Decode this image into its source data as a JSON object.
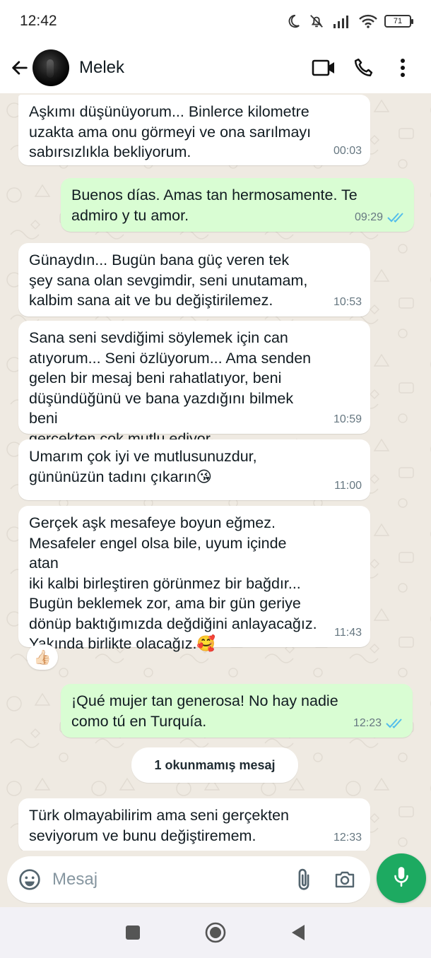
{
  "status_bar": {
    "time": "12:42",
    "battery": "71"
  },
  "header": {
    "contact_name": "Melek"
  },
  "messages": [
    {
      "direction": "in",
      "text": "Aşkımı düşünüyorum... Binlerce kilometre\nuzakta ama onu görmeyi ve ona sarılmayı\nsabırsızlıkla bekliyorum.",
      "time": "00:03"
    },
    {
      "direction": "out",
      "text": "Buenos días. Amas tan hermosamente. Te\nadmiro y tu amor.",
      "time": "09:29",
      "status": "read"
    },
    {
      "direction": "in",
      "text": "Günaydın... Bugün bana güç veren tek\nşey sana olan sevgimdir, seni unutamam,\nkalbim sana ait ve bu değiştirilemez.",
      "time": "10:53"
    },
    {
      "direction": "in",
      "text": "Sana seni sevdiğimi söylemek için can\natıyorum... Seni özlüyorum... Ama senden\ngelen bir mesaj beni rahatlatıyor, beni\ndüşündüğünü ve bana yazdığını bilmek beni\ngerçekten çok mutlu ediyor.",
      "time": "10:59"
    },
    {
      "direction": "in",
      "text": "Umarım çok iyi ve mutlusunuzdur,\ngününüzün tadını çıkarın😘",
      "time": "11:00"
    },
    {
      "direction": "in",
      "text": "Gerçek aşk mesafeye boyun eğmez.\nMesafeler engel olsa bile, uyum içinde atan\niki kalbi birleştiren görünmez bir bağdır...\nBugün beklemek zor, ama bir gün geriye\ndönüp baktığımızda değdiğini anlayacağız.\nYakında birlikte olacağız.🥰",
      "time": "11:43",
      "reaction": "👍🏻"
    },
    {
      "direction": "out",
      "text": "¡Qué mujer tan generosa! No hay nadie\ncomo tú en Turquía.",
      "time": "12:23",
      "status": "read"
    },
    {
      "direction": "in",
      "text": "Türk olmayabilirim ama seni gerçekten\nseviyorum ve bunu değiştiremem.",
      "time": "12:33"
    }
  ],
  "unread_banner": "1 okunmamış mesaj",
  "input": {
    "placeholder": "Mesaj"
  },
  "colors": {
    "outgoing_bubble": "#d9fdd3",
    "incoming_bubble": "#ffffff",
    "read_ticks": "#53bdeb",
    "mic_button": "#1daa61",
    "chat_background": "#efeae2"
  },
  "icons": [
    "back-arrow-icon",
    "video-call-icon",
    "phone-icon",
    "more-vert-icon",
    "emoji-icon",
    "attach-icon",
    "camera-icon",
    "mic-icon",
    "recents-icon",
    "home-icon",
    "back-icon"
  ]
}
